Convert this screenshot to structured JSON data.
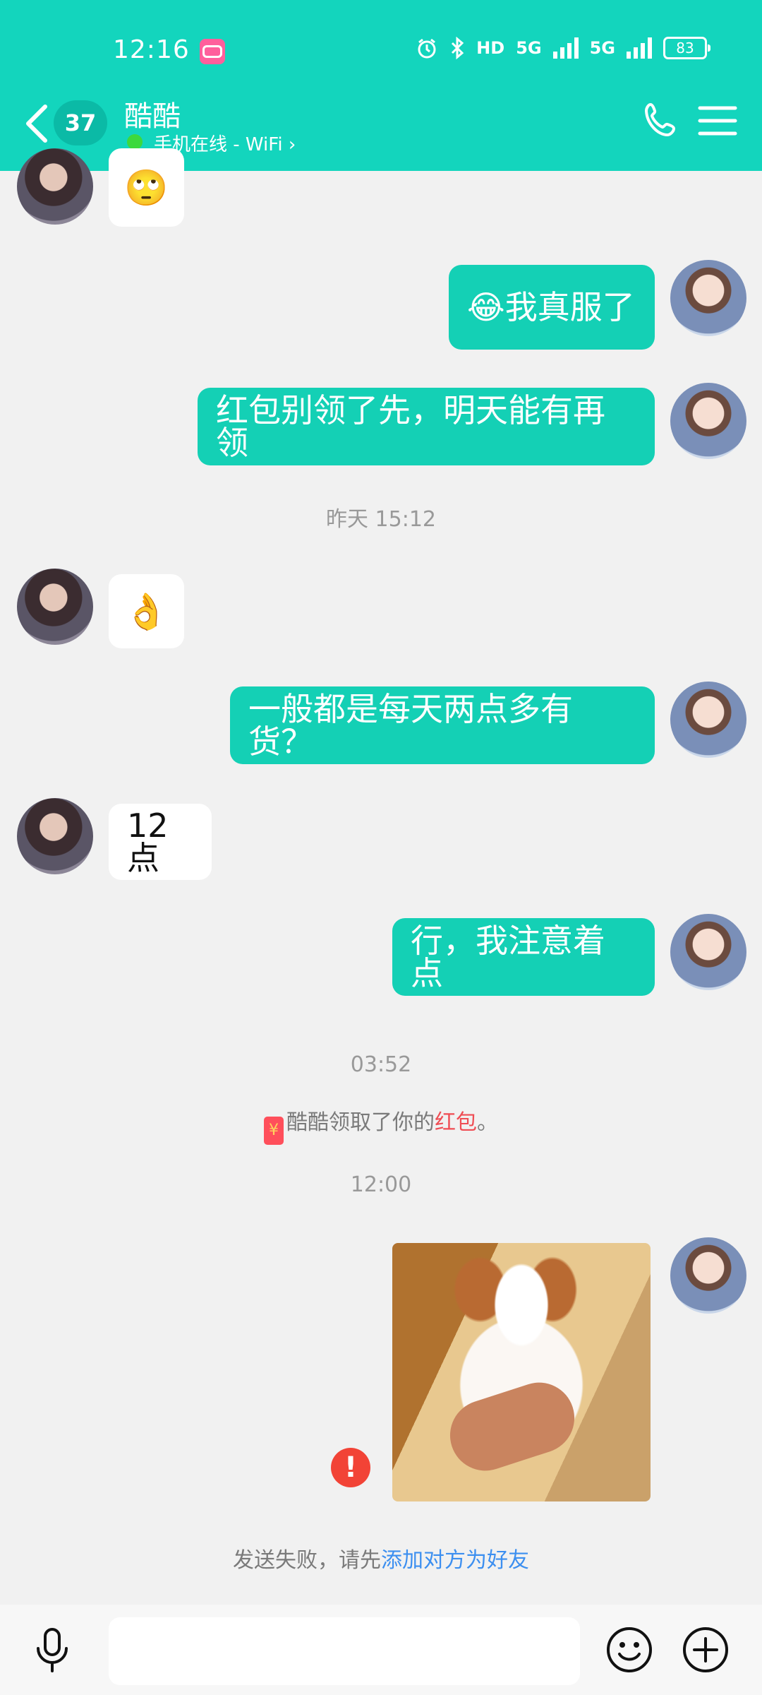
{
  "status_bar": {
    "time": "12:16",
    "hd_label": "HD",
    "net1": "5G",
    "net2": "5G",
    "battery": "83"
  },
  "header": {
    "unread_count": "37",
    "contact_name": "酷酷",
    "online_status": "手机在线 - WiFi ›"
  },
  "messages": [
    {
      "from": "other",
      "text": "🙄"
    },
    {
      "from": "me",
      "text": "😂我真服了"
    },
    {
      "from": "me",
      "text": "红包别领了先，明天能有再领"
    },
    {
      "from": "other",
      "text": "👌"
    },
    {
      "from": "me",
      "text": "一般都是每天两点多有货？"
    },
    {
      "from": "other",
      "text": "12点"
    },
    {
      "from": "me",
      "text": "行，我注意着点"
    }
  ],
  "timestamps": [
    "昨天 15:12",
    "03:52",
    "12:00"
  ],
  "system_notes": {
    "redpacket_icon": "¥",
    "redpacket_prefix": "酷酷领取了你的",
    "redpacket_link": "红包",
    "redpacket_suffix": "。",
    "failed_prefix": "发送失败，请先",
    "failed_link": "添加对方为好友"
  },
  "error_icon_symbol": "!",
  "input_bar": {
    "placeholder": ""
  },
  "colors": {
    "header": "#13d5bd",
    "my_bubble": "#14d0b5",
    "link_red": "#ef4d54",
    "link_blue": "#3c8ff0",
    "error": "#f24336"
  }
}
